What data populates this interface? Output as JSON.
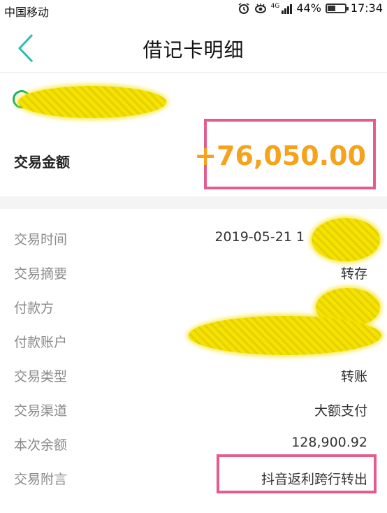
{
  "status_bar": {
    "carrier": "中国移动",
    "network": "4G",
    "battery_percent": "44%",
    "time": "17:34",
    "icons": [
      "alarm-icon",
      "eye-icon",
      "signal-icon",
      "battery-icon"
    ]
  },
  "nav": {
    "title": "借记卡明细",
    "back_icon": "chevron-left-icon"
  },
  "summary": {
    "amount_label": "交易金额",
    "amount_value": "+76,050.00",
    "amount_color": "#f5a21c",
    "highlight_color": "#e65b8d"
  },
  "details": [
    {
      "label": "交易时间",
      "value": "2019-05-21 1"
    },
    {
      "label": "交易摘要",
      "value": "转存"
    },
    {
      "label": "付款方",
      "value": ""
    },
    {
      "label": "付款账户",
      "value": ""
    },
    {
      "label": "交易类型",
      "value": "转账"
    },
    {
      "label": "交易渠道",
      "value": "大额支付"
    },
    {
      "label": "本次余额",
      "value": "128,900.92"
    },
    {
      "label": "交易附言",
      "value": "抖音返利跨行转出"
    }
  ]
}
